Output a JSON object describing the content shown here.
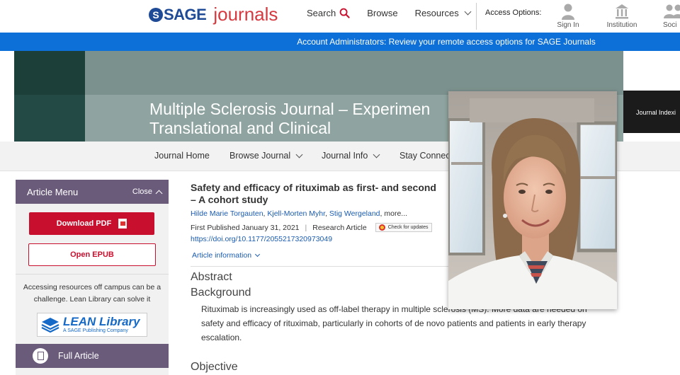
{
  "header": {
    "logo_sage": "SAGE",
    "logo_journals": "journals",
    "nav": [
      {
        "label": "Search"
      },
      {
        "label": "Browse"
      },
      {
        "label": "Resources"
      }
    ],
    "access_label": "Access Options:",
    "access_options": [
      {
        "label": "Sign In",
        "icon": "person-icon"
      },
      {
        "label": "Institution",
        "icon": "institution-icon"
      },
      {
        "label": "Soci",
        "icon": "society-icon"
      }
    ]
  },
  "notice": "Account Administrators: Review your remote access options for SAGE Journals",
  "journal": {
    "title_line1": "Multiple Sclerosis Journal – Experimen",
    "title_line2": "Translational and Clinical",
    "right_label": "Journal Indexi",
    "nav": [
      "Journal Home",
      "Browse Journal",
      "Journal Info",
      "Stay Connec"
    ]
  },
  "sidebar": {
    "menu_title": "Article Menu",
    "close_label": "Close",
    "download_pdf": "Download PDF",
    "open_epub": "Open EPUB",
    "offcampus_line1": "Accessing resources off campus can be a",
    "offcampus_line2": "challenge. Lean Library can solve it",
    "lean_main": "LEAN Library",
    "lean_sub": "A SAGE Publishing Company",
    "full_article": "Full Article"
  },
  "article": {
    "title_line1": "Safety and efficacy of rituximab as first- and second",
    "title_line2": "– A cohort study",
    "authors": [
      "Hilde Marie Torgauten",
      "Kjell-Morten Myhr",
      "Stig Wergeland"
    ],
    "authors_more": "more...",
    "first_published": "First Published January 31, 2021",
    "article_type": "Research Article",
    "check_updates": "Check for updates",
    "doi": "https://doi.org/10.1177/2055217320973049",
    "article_info": "Article information",
    "abstract_heading": "Abstract",
    "background_heading": "Background",
    "background_text": "Rituximab is increasingly used as off-label therapy in multiple sclerosis (MS). More data are needed on safety and efficacy of rituximab, particularly in cohorts of de novo patients and patients in early therapy escalation.",
    "objective_heading": "Objective"
  },
  "colors": {
    "sage_blue": "#1e4a96",
    "journals_red": "#d6393f",
    "notice_blue": "#0d6fd8",
    "menu_purple": "#6a5b7b",
    "pdf_red": "#c8102e",
    "link_blue": "#1a5bb0"
  }
}
